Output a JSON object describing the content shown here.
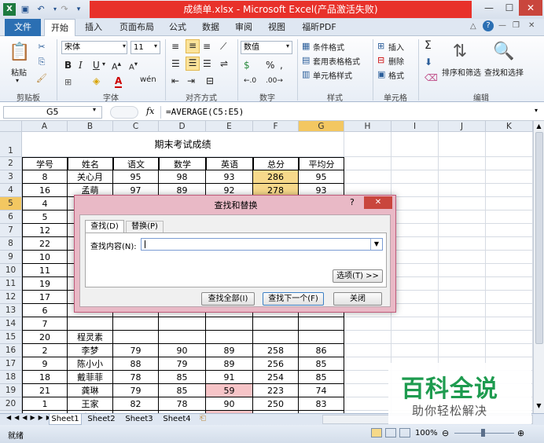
{
  "window": {
    "title": "成绩单.xlsx - Microsoft Excel(产品激活失败)",
    "min": "—",
    "max": "☐",
    "close": "✕"
  },
  "tabs": {
    "file": "文件",
    "items": [
      "开始",
      "插入",
      "页面布局",
      "公式",
      "数据",
      "审阅",
      "视图",
      "福昕PDF"
    ]
  },
  "ribbon": {
    "paste": "粘贴",
    "font_name": "宋体",
    "font_size": "11",
    "bold": "B",
    "italic": "I",
    "underline": "U",
    "wen": "wén",
    "number_format": "数值",
    "cond_format": "条件格式",
    "table_format": "套用表格格式",
    "cell_style": "单元格样式",
    "insert": "插入",
    "delete": "删除",
    "format": "格式",
    "sum": "Σ",
    "sort_filter": "排序和筛选",
    "find_select": "查找和选择",
    "groups": [
      "剪贴板",
      "字体",
      "对齐方式",
      "数字",
      "样式",
      "单元格",
      "编辑"
    ]
  },
  "formula_bar": {
    "name_box": "G5",
    "fx": "fx",
    "formula": "=AVERAGE(C5:E5)"
  },
  "columns": [
    "A",
    "B",
    "C",
    "D",
    "E",
    "F",
    "G",
    "H",
    "I",
    "J",
    "K"
  ],
  "sheet": {
    "title": "期末考试成绩",
    "headers": [
      "学号",
      "姓名",
      "语文",
      "数学",
      "英语",
      "总分",
      "平均分"
    ],
    "rows": [
      [
        "8",
        "关心月",
        "95",
        "98",
        "93",
        "286",
        "95"
      ],
      [
        "16",
        "孟萌",
        "97",
        "89",
        "92",
        "278",
        "93"
      ],
      [
        "4",
        "张国易",
        "",
        "",
        "",
        "",
        ""
      ],
      [
        "5",
        "",
        "",
        "",
        "",
        "",
        ""
      ],
      [
        "12",
        "",
        "",
        "",
        "",
        "",
        ""
      ],
      [
        "22",
        "",
        "",
        "",
        "",
        "",
        ""
      ],
      [
        "10",
        "",
        "",
        "",
        "",
        "",
        ""
      ],
      [
        "11",
        "",
        "",
        "",
        "",
        "",
        ""
      ],
      [
        "19",
        "",
        "",
        "",
        "",
        "",
        ""
      ],
      [
        "17",
        "",
        "",
        "",
        "",
        "",
        ""
      ],
      [
        "6",
        "",
        "",
        "",
        "",
        "",
        ""
      ],
      [
        "7",
        "",
        "",
        "",
        "",
        "",
        ""
      ],
      [
        "20",
        "程灵素",
        "",
        "",
        "",
        "",
        ""
      ],
      [
        "2",
        "李梦",
        "79",
        "90",
        "89",
        "258",
        "86"
      ],
      [
        "9",
        "陈小小",
        "88",
        "79",
        "89",
        "256",
        "85"
      ],
      [
        "18",
        "戴菲菲",
        "78",
        "85",
        "91",
        "254",
        "85"
      ],
      [
        "21",
        "龚琳",
        "79",
        "85",
        "59",
        "223",
        "74"
      ],
      [
        "1",
        "王家",
        "82",
        "78",
        "90",
        "250",
        "83"
      ],
      [
        "15",
        "嘉佳",
        "82",
        "79",
        "56",
        "217",
        "72"
      ],
      [
        "14",
        "沈佳宜",
        "75",
        "80",
        "89",
        "244",
        "81"
      ],
      [
        "13",
        "陆遥",
        "50",
        "80",
        "89",
        "219",
        "73"
      ]
    ],
    "row_numbers": [
      "1",
      "2",
      "3",
      "4",
      "5",
      "6",
      "7",
      "8",
      "9",
      "10",
      "11",
      "12",
      "13",
      "14",
      "15",
      "16",
      "17",
      "18",
      "19",
      "20",
      "21",
      "22",
      "23"
    ]
  },
  "sheets": [
    "Sheet1",
    "Sheet2",
    "Sheet3",
    "Sheet4"
  ],
  "status": {
    "ready": "就绪",
    "zoom": "100%"
  },
  "dialog": {
    "title": "查找和替换",
    "help": "?",
    "close": "✕",
    "tab_find": "查找(D)",
    "tab_replace": "替换(P)",
    "find_label": "查找内容(N):",
    "find_value": "",
    "options": "选项(T) >>",
    "find_all": "查找全部(I)",
    "find_next": "查找下一个(F)",
    "close_btn": "关闭"
  },
  "watermark": {
    "main": "百科全说",
    "sub": "助你轻松解决"
  },
  "colors": {
    "highlight_yellow": "#f7d98b",
    "highlight_pink": "#f6c4c7",
    "title_red": "#e8312a",
    "watermark_green": "#1e9b4f"
  }
}
